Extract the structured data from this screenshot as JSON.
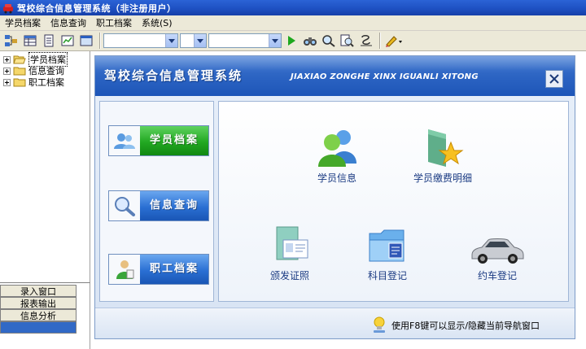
{
  "window": {
    "title": "驾校综合信息管理系统（非注册用户）"
  },
  "menu": {
    "items": [
      "学员档案",
      "信息查询",
      "职工档案",
      "系统(S)"
    ]
  },
  "tree": {
    "items": [
      {
        "label": "学员档案",
        "selected": true
      },
      {
        "label": "信息查询",
        "selected": false
      },
      {
        "label": "职工档案",
        "selected": false
      }
    ]
  },
  "leftnav": {
    "items": [
      "录入窗口",
      "报表输出",
      "信息分析"
    ]
  },
  "dialog": {
    "title": "驾校综合信息管理系统",
    "pinyin": "JIAXIAO ZONGHE XINX IGUANLI XITONG",
    "categories": [
      "学员档案",
      "信息查询",
      "职工档案"
    ],
    "modules": [
      "学员信息",
      "学员缴费明细",
      "颁发证照",
      "科目登记",
      "约车登记"
    ],
    "hint": "使用F8键可以显示/隐藏当前导航窗口"
  },
  "colors": {
    "titlebar": "#1d4fc0",
    "header": "#2e66c4",
    "green": "#22a822",
    "blue": "#2a6fd3",
    "accent_text": "#1a3a82"
  },
  "icons": [
    "app-icon",
    "grid-icon",
    "table-icon",
    "document-icon",
    "chart-icon",
    "window-icon",
    "play-icon",
    "binoculars-icon",
    "search-icon",
    "zoom-icon",
    "print-icon",
    "pencil-icon"
  ]
}
